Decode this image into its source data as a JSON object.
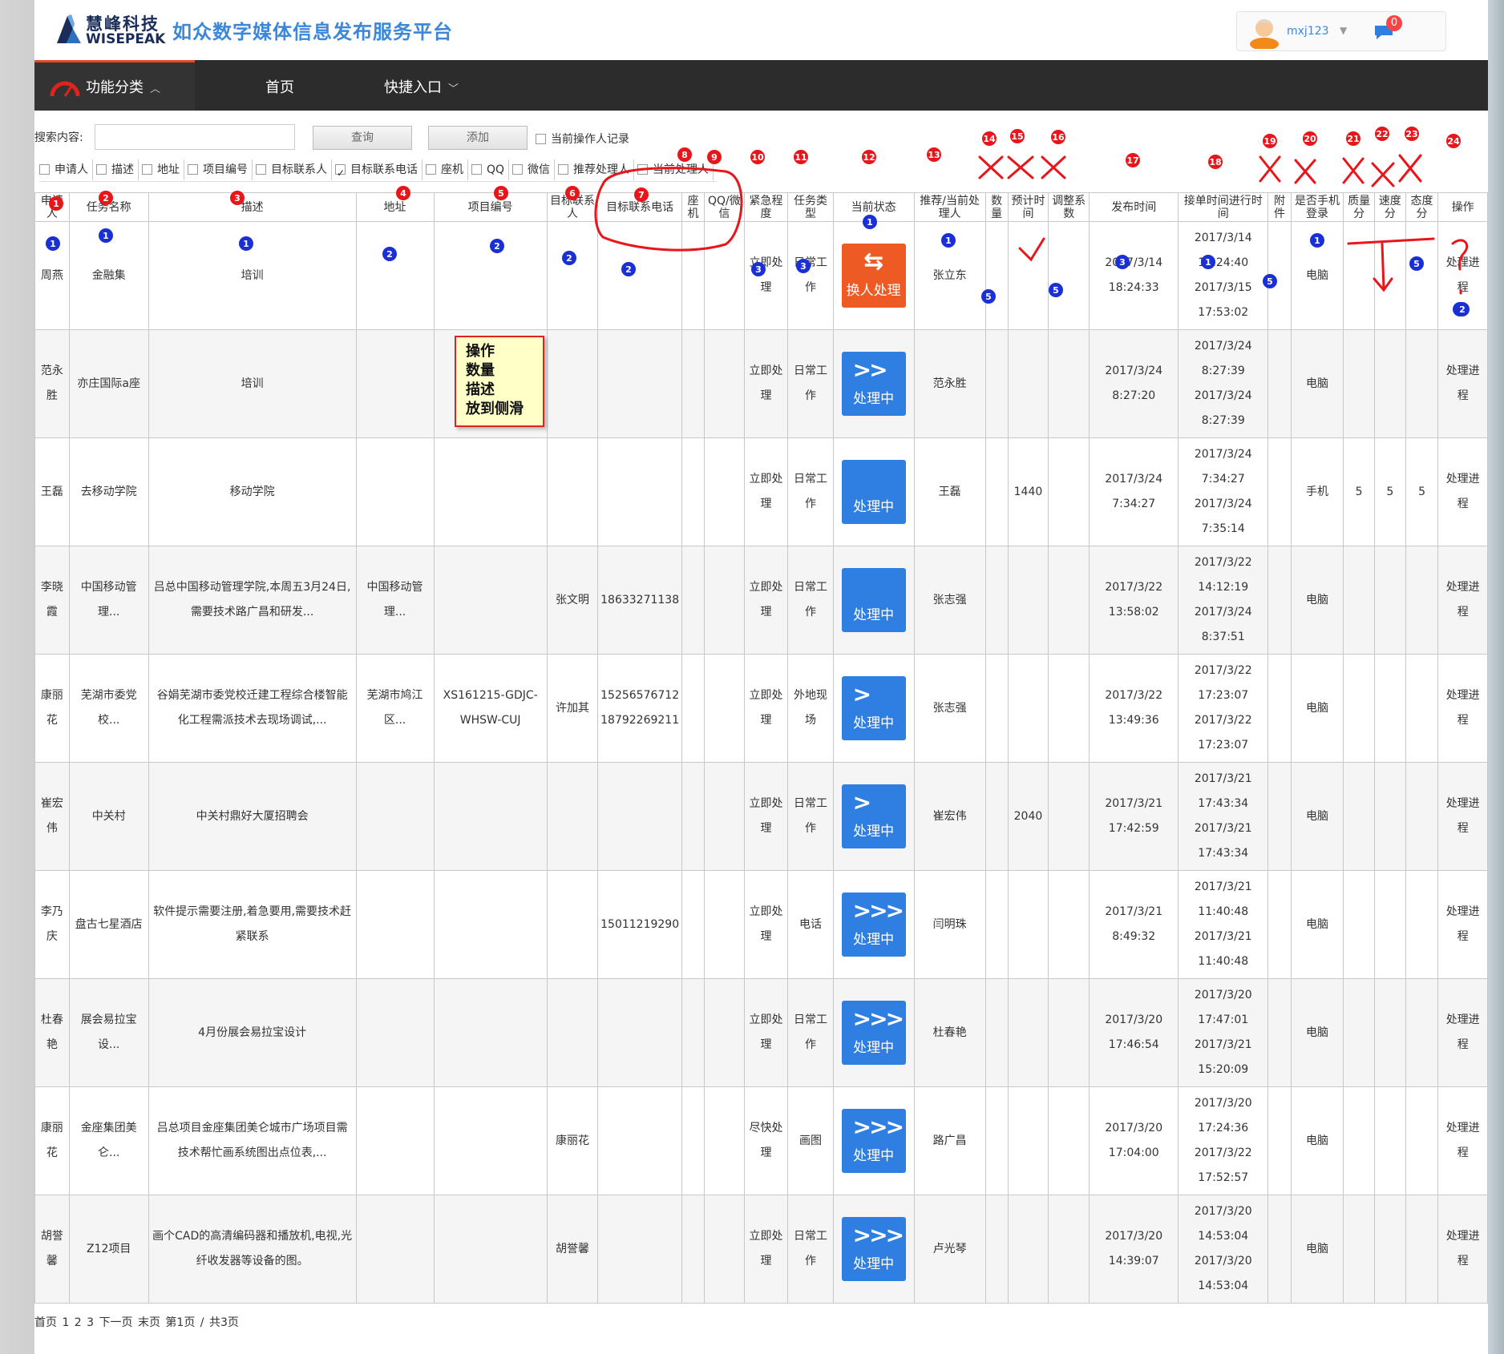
{
  "brand": {
    "logo_cn": "慧峰科技",
    "logo_en": "WISEPEAK",
    "site_title": "如众数字媒体信息发布服务平台"
  },
  "user": {
    "name": "mxj123",
    "messages": "0"
  },
  "nav": {
    "items": [
      "功能分类",
      "首页",
      "快捷入口"
    ]
  },
  "search": {
    "label": "搜索内容:",
    "input_value": "",
    "query_button": "查询",
    "add_button": "添加",
    "current_operator_label": "当前操作人记录",
    "filters": [
      {
        "label": "申请人",
        "checked": false
      },
      {
        "label": "描述",
        "checked": false
      },
      {
        "label": "地址",
        "checked": false
      },
      {
        "label": "项目编号",
        "checked": false
      },
      {
        "label": "目标联系人",
        "checked": false
      },
      {
        "label": "目标联系电话",
        "checked": true
      },
      {
        "label": "座机",
        "checked": false
      },
      {
        "label": "QQ",
        "checked": false
      },
      {
        "label": "微信",
        "checked": false
      },
      {
        "label": "推荐处理人",
        "checked": false
      },
      {
        "label": "当前处理人",
        "checked": false
      }
    ]
  },
  "table": {
    "headers": [
      "申请人",
      "任务名称",
      "描述",
      "地址",
      "项目编号",
      "目标联系人",
      "目标联系电话",
      "座机",
      "QQ/微信",
      "紧急程度",
      "任务类型",
      "当前状态",
      "推荐/当前处理人",
      "数量",
      "预计时间",
      "调整系数",
      "发布时间",
      "接单时间进行时间",
      "附件",
      "是否手机登录",
      "质量分",
      "速度分",
      "态度分",
      "操作"
    ],
    "rows": [
      {
        "applicant": "周燕",
        "name": "金融集",
        "desc": "培训",
        "addr": "",
        "proj": "",
        "contact": "",
        "phone": "",
        "landline": "",
        "qq": "",
        "urgency": "立即处理",
        "type": "日常工作",
        "state_icon": "⇆",
        "state_text": "换人处理",
        "state_color": "orange",
        "handler": "张立东",
        "qty": "",
        "est": "",
        "adj": "",
        "publish": "2017/3/14 18:24:33",
        "times": "2017/3/14 18:24:40 2017/3/15 17:53:02",
        "attach": "",
        "mobile": "电脑",
        "quality": "",
        "speed": "",
        "attitude": "",
        "op": "处理进程"
      },
      {
        "applicant": "范永胜",
        "name": "亦庄国际a座",
        "desc": "培训",
        "addr": "",
        "proj": "",
        "contact": "",
        "phone": "",
        "landline": "",
        "qq": "",
        "urgency": "立即处理",
        "type": "日常工作",
        "state_icon": ">>",
        "state_text": "处理中",
        "state_color": "blue",
        "handler": "范永胜",
        "qty": "",
        "est": "",
        "adj": "",
        "publish": "2017/3/24 8:27:20",
        "times": "2017/3/24 8:27:39 2017/3/24 8:27:39",
        "attach": "",
        "mobile": "电脑",
        "quality": "",
        "speed": "",
        "attitude": "",
        "op": "处理进程"
      },
      {
        "applicant": "王磊",
        "name": "去移动学院",
        "desc": "移动学院",
        "addr": "",
        "proj": "",
        "contact": "",
        "phone": "",
        "landline": "",
        "qq": "",
        "urgency": "立即处理",
        "type": "日常工作",
        "state_icon": "",
        "state_text": "处理中",
        "state_color": "blue",
        "handler": "王磊",
        "qty": "",
        "est": "1440",
        "adj": "",
        "publish": "2017/3/24 7:34:27",
        "times": "2017/3/24 7:34:27 2017/3/24 7:35:14",
        "attach": "",
        "mobile": "手机",
        "quality": "5",
        "speed": "5",
        "attitude": "5",
        "op": "处理进程"
      },
      {
        "applicant": "李晓霞",
        "name": "中国移动管理...",
        "desc": "吕总中国移动管理学院,本周五3月24日,需要技术路广昌和研发...",
        "addr": "中国移动管理...",
        "proj": "",
        "contact": "张文明",
        "phone": "18633271138",
        "landline": "",
        "qq": "",
        "urgency": "立即处理",
        "type": "日常工作",
        "state_icon": "",
        "state_text": "处理中",
        "state_color": "blue",
        "handler": "张志强",
        "qty": "",
        "est": "",
        "adj": "",
        "publish": "2017/3/22 13:58:02",
        "times": "2017/3/22 14:12:19 2017/3/24 8:37:51",
        "attach": "",
        "mobile": "电脑",
        "quality": "",
        "speed": "",
        "attitude": "",
        "op": "处理进程"
      },
      {
        "applicant": "康丽花",
        "name": "芜湖市委党校...",
        "desc": "谷娟芜湖市委党校迁建工程综合楼智能化工程需派技术去现场调试,...",
        "addr": "芜湖市鸠江区...",
        "proj": "XS161215-GDJC-WHSW-CUJ",
        "contact": "许加其",
        "phone": "15256576712 18792269211",
        "landline": "",
        "qq": "",
        "urgency": "立即处理",
        "type": "外地现场",
        "state_icon": ">",
        "state_text": "处理中",
        "state_color": "blue",
        "handler": "张志强",
        "qty": "",
        "est": "",
        "adj": "",
        "publish": "2017/3/22 13:49:36",
        "times": "2017/3/22 17:23:07 2017/3/22 17:23:07",
        "attach": "",
        "mobile": "电脑",
        "quality": "",
        "speed": "",
        "attitude": "",
        "op": "处理进程"
      },
      {
        "applicant": "崔宏伟",
        "name": "中关村",
        "desc": "中关村鼎好大厦招聘会",
        "addr": "",
        "proj": "",
        "contact": "",
        "phone": "",
        "landline": "",
        "qq": "",
        "urgency": "立即处理",
        "type": "日常工作",
        "state_icon": ">",
        "state_text": "处理中",
        "state_color": "blue",
        "handler": "崔宏伟",
        "qty": "",
        "est": "2040",
        "adj": "",
        "publish": "2017/3/21 17:42:59",
        "times": "2017/3/21 17:43:34 2017/3/21 17:43:34",
        "attach": "",
        "mobile": "电脑",
        "quality": "",
        "speed": "",
        "attitude": "",
        "op": "处理进程"
      },
      {
        "applicant": "李乃庆",
        "name": "盘古七星酒店",
        "desc": "软件提示需要注册,着急要用,需要技术赶紧联系",
        "addr": "",
        "proj": "",
        "contact": "",
        "phone": "15011219290",
        "landline": "",
        "qq": "",
        "urgency": "立即处理",
        "type": "电话",
        "state_icon": ">>>",
        "state_text": "处理中",
        "state_color": "blue",
        "handler": "闫明珠",
        "qty": "",
        "est": "",
        "adj": "",
        "publish": "2017/3/21 8:49:32",
        "times": "2017/3/21 11:40:48 2017/3/21 11:40:48",
        "attach": "",
        "mobile": "电脑",
        "quality": "",
        "speed": "",
        "attitude": "",
        "op": "处理进程"
      },
      {
        "applicant": "杜春艳",
        "name": "展会易拉宝设...",
        "desc": "4月份展会易拉宝设计",
        "addr": "",
        "proj": "",
        "contact": "",
        "phone": "",
        "landline": "",
        "qq": "",
        "urgency": "立即处理",
        "type": "日常工作",
        "state_icon": ">>>",
        "state_text": "处理中",
        "state_color": "blue",
        "handler": "杜春艳",
        "qty": "",
        "est": "",
        "adj": "",
        "publish": "2017/3/20 17:46:54",
        "times": "2017/3/20 17:47:01 2017/3/21 15:20:09",
        "attach": "",
        "mobile": "电脑",
        "quality": "",
        "speed": "",
        "attitude": "",
        "op": "处理进程"
      },
      {
        "applicant": "康丽花",
        "name": "金座集团美仑...",
        "desc": "吕总项目金座集团美仑城市广场项目需技术帮忙画系统图出点位表,...",
        "addr": "",
        "proj": "",
        "contact": "康丽花",
        "phone": "",
        "landline": "",
        "qq": "",
        "urgency": "尽快处理",
        "type": "画图",
        "state_icon": ">>>",
        "state_text": "处理中",
        "state_color": "blue",
        "handler": "路广昌",
        "qty": "",
        "est": "",
        "adj": "",
        "publish": "2017/3/20 17:04:00",
        "times": "2017/3/20 17:24:36 2017/3/22 17:52:57",
        "attach": "",
        "mobile": "电脑",
        "quality": "",
        "speed": "",
        "attitude": "",
        "op": "处理进程"
      },
      {
        "applicant": "胡誉馨",
        "name": "Z12项目",
        "desc": "画个CAD的高清编码器和播放机,电视,光纤收发器等设备的图。",
        "addr": "",
        "proj": "",
        "contact": "胡誉馨",
        "phone": "",
        "landline": "",
        "qq": "",
        "urgency": "立即处理",
        "type": "日常工作",
        "state_icon": ">>>",
        "state_text": "处理中",
        "state_color": "blue",
        "handler": "卢光琴",
        "qty": "",
        "est": "",
        "adj": "",
        "publish": "2017/3/20 14:39:07",
        "times": "2017/3/20 14:53:04 2017/3/20 14:53:04",
        "attach": "",
        "mobile": "电脑",
        "quality": "",
        "speed": "",
        "attitude": "",
        "op": "处理进程"
      }
    ]
  },
  "note": {
    "lines": [
      "操作",
      "数量",
      "描述",
      "放到侧滑"
    ]
  },
  "pager": {
    "text": "首页 1 2 3 下一页 末页 第1页 / 共3页"
  },
  "annotation_colors": {
    "red": "#e8161a",
    "blue": "#1a2fd6"
  },
  "red_markers": [
    "1",
    "2",
    "3",
    "4",
    "5",
    "6",
    "7",
    "8",
    "9",
    "10",
    "11",
    "12",
    "13",
    "14",
    "15",
    "16",
    "17",
    "18",
    "19",
    "20",
    "21",
    "22",
    "23",
    "24"
  ],
  "blue_markers": [
    "1",
    "1",
    "1",
    "2",
    "2",
    "2",
    "2",
    "1",
    "3",
    "1",
    "3",
    "3",
    "1",
    "5",
    "5",
    "5",
    "5",
    "1",
    "5",
    "2"
  ]
}
